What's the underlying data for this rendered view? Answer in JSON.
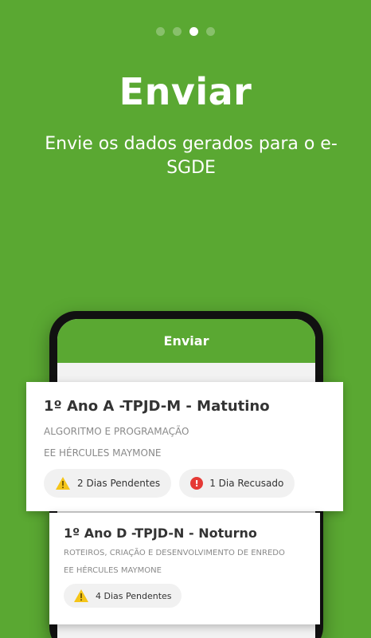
{
  "colors": {
    "primary": "#5aa832",
    "warning": "#f5c518",
    "error": "#e53935"
  },
  "pager": {
    "total": 4,
    "active_index": 2
  },
  "title": "Enviar",
  "subtitle": "Envie os dados gerados para o e-SGDE",
  "phone": {
    "app_bar_title": "Enviar"
  },
  "cards": [
    {
      "title": "1º Ano A -TPJD-M - Matutino",
      "subject": "ALGORITMO E PROGRAMAÇÃO",
      "school": "EE HÉRCULES MAYMONE",
      "badges": [
        {
          "icon": "warning-icon",
          "label": "2 Dias Pendentes"
        },
        {
          "icon": "error-icon",
          "label": "1 Dia Recusado"
        }
      ]
    },
    {
      "title": "1º Ano D -TPJD-N - Noturno",
      "subject": "ROTEIROS, CRIAÇÃO E DESENVOLVIMENTO DE ENREDO",
      "school": "EE HÉRCULES MAYMONE",
      "badges": [
        {
          "icon": "warning-icon",
          "label": "4 Dias Pendentes"
        }
      ]
    }
  ]
}
